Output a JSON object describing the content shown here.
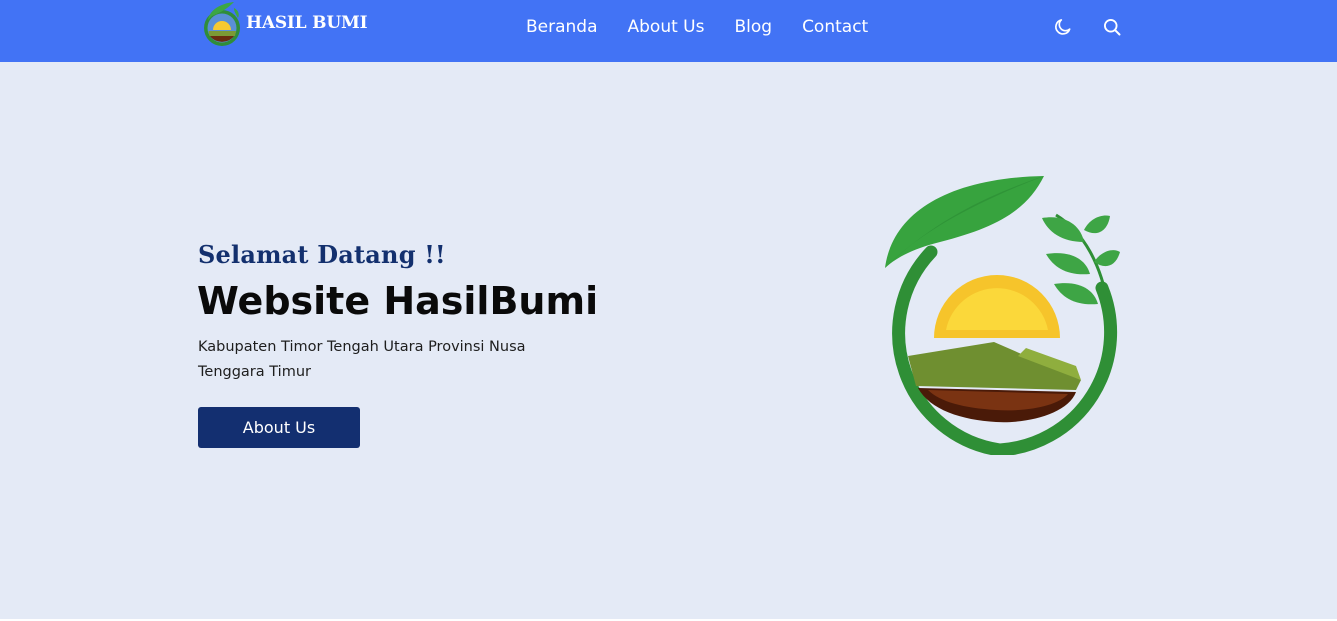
{
  "navbar": {
    "brand": "HASIL BUMI",
    "links": [
      "Beranda",
      "About Us",
      "Blog",
      "Contact"
    ],
    "icons": [
      "moon-icon",
      "search-icon"
    ],
    "background": "#4273f5"
  },
  "hero": {
    "subtitle": "Selamat Datang !!",
    "title": "Website HasilBumi",
    "description": "Kabupaten Timor Tengah Utara Provinsi Nusa Tenggara Timur",
    "button_label": "About Us",
    "logo_icon": "leaf-sun-landscape-logo",
    "background": "#e4eaf6",
    "button_color": "#132f70"
  }
}
